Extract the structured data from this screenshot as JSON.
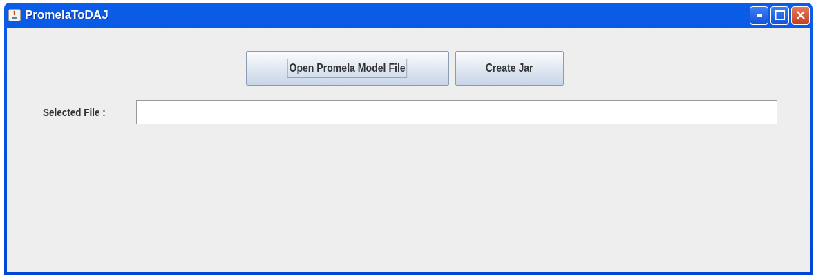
{
  "window": {
    "title": "PromelaToDAJ"
  },
  "buttons": [
    {
      "label": "Open Promela Model File",
      "focused": true
    },
    {
      "label": "Create Jar",
      "focused": false
    }
  ],
  "selected_file": {
    "label": "Selected File :"
  }
}
